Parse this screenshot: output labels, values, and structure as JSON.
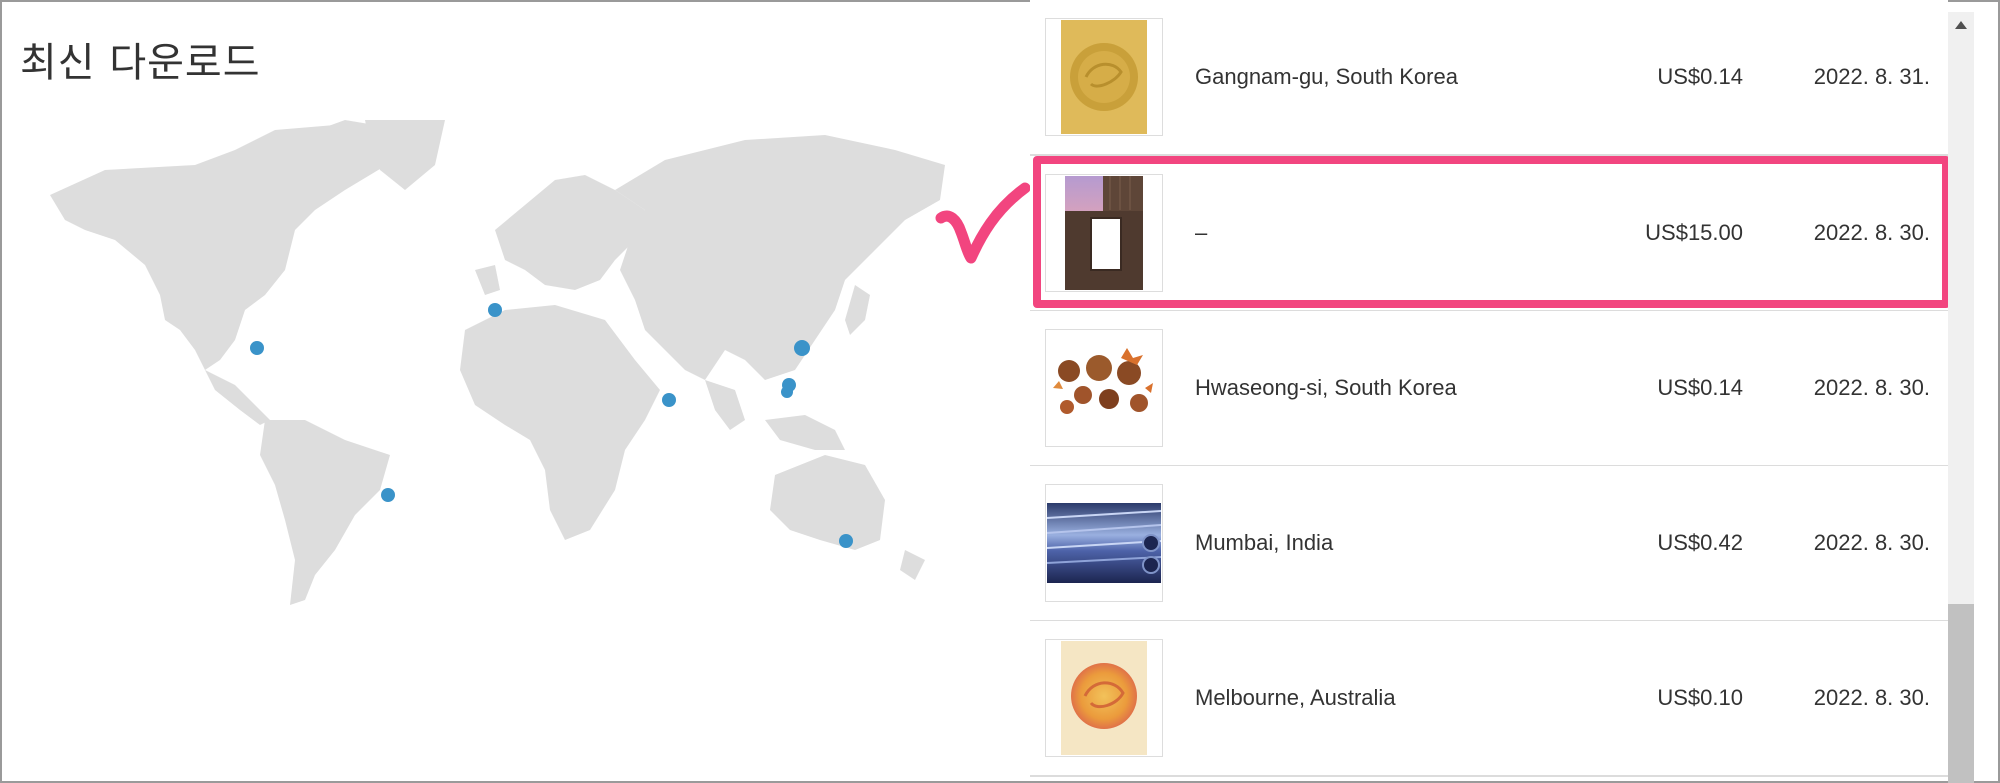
{
  "title": "최신 다운로드",
  "colors": {
    "accent": "#f2457f",
    "map_land": "#dddddd",
    "marker": "#3a93c9",
    "divider": "#dcdcdc"
  },
  "downloads": [
    {
      "location": "Gangnam-gu, South Korea",
      "price": "US$0.14",
      "date": "2022. 8. 31.",
      "thumb": "gold-dragon-medallion"
    },
    {
      "location": "–",
      "price": "US$15.00",
      "date": "2022. 8. 30.",
      "thumb": "building-billboard"
    },
    {
      "location": "Hwaseong-si, South Korea",
      "price": "US$0.14",
      "date": "2022. 8. 30.",
      "thumb": "chestnuts"
    },
    {
      "location": "Mumbai, India",
      "price": "US$0.42",
      "date": "2022. 8. 30.",
      "thumb": "steel-pipes"
    },
    {
      "location": "Melbourne, Australia",
      "price": "US$0.10",
      "date": "2022. 8. 30.",
      "thumb": "orange-dragon-medallion"
    }
  ],
  "highlighted_row": 1,
  "annotation_icon": "checkmark-icon"
}
